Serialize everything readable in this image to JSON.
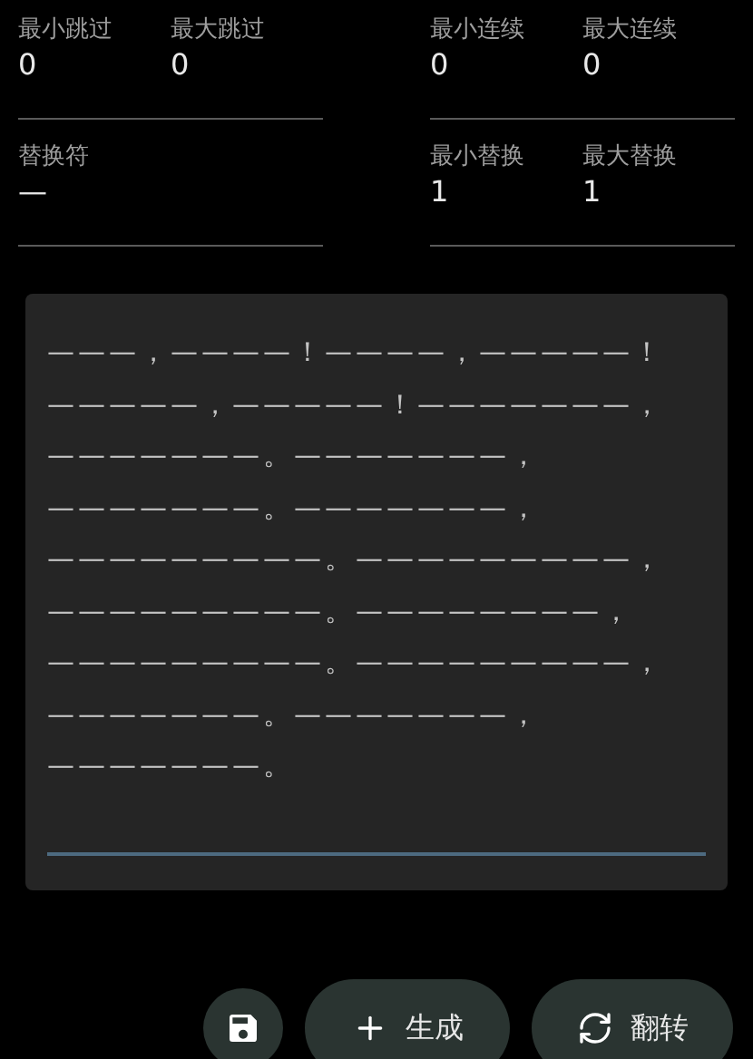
{
  "field_groups": [
    {
      "fields": [
        {
          "label": "最小跳过",
          "value": "0"
        },
        {
          "label": "最大跳过",
          "value": "0"
        }
      ]
    },
    {
      "fields": [
        {
          "label": "最小连续",
          "value": "0"
        },
        {
          "label": "最大连续",
          "value": "0"
        }
      ]
    },
    {
      "fields": [
        {
          "label": "替换符",
          "value": "—"
        }
      ]
    },
    {
      "fields": [
        {
          "label": "最小替换",
          "value": "1"
        },
        {
          "label": "最大替换",
          "value": "1"
        }
      ]
    }
  ],
  "output": {
    "text": "———，————！————，—————！—————，—————！———————，———————。———————，———————。———————，—————————。—————————，—————————。————————，—————————。—————————，———————。———————，———————。"
  },
  "buttons": [
    {
      "kind": "save"
    },
    {
      "kind": "add",
      "label": "生成"
    },
    {
      "kind": "flip",
      "label": "翻转"
    }
  ]
}
